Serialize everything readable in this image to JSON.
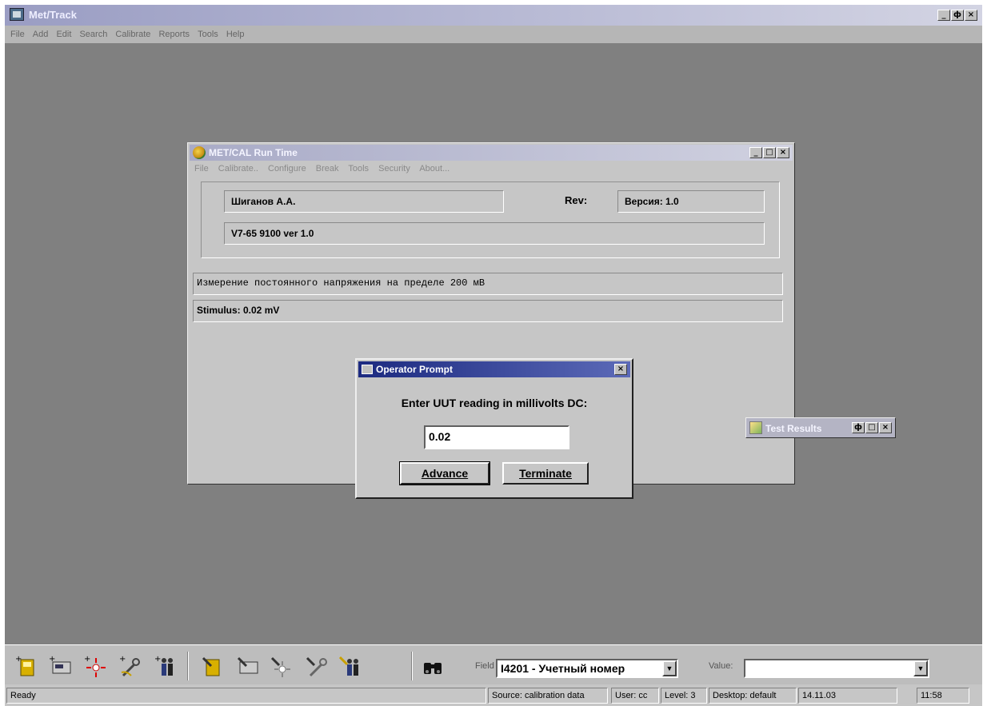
{
  "app": {
    "title": "Met/Track",
    "menu": [
      "File",
      "Add",
      "Edit",
      "Search",
      "Calibrate",
      "Reports",
      "Tools",
      "Help"
    ],
    "window_controls": {
      "minimize": "_",
      "restore": "ф",
      "close": "×"
    }
  },
  "metcal": {
    "title": "MET/CAL Run Time",
    "menu": [
      "File",
      "Calibrate..",
      "Configure",
      "Break",
      "Tools",
      "Security",
      "About..."
    ],
    "operator_name": "Шиганов А.А.",
    "rev_label": "Rev:",
    "rev_value": "Версия: 1.0",
    "procedure": "V7-65 9100 ver 1.0",
    "step_description": "Измерение постоянного напряжения на пределе 200 мВ",
    "stimulus": "Stimulus:  0.02 mV"
  },
  "prompt": {
    "title": "Operator Prompt",
    "message": "Enter UUT reading in millivolts DC:",
    "input_value": "0.02",
    "advance_label": "Advance",
    "terminate_label": "Terminate"
  },
  "test_results": {
    "title": "Test Results"
  },
  "toolbar": {
    "field_label": "Field",
    "field_value": "I4201 - Учетный номер",
    "value_label": "Value:",
    "value_value": ""
  },
  "status": {
    "ready": "Ready",
    "source": "Source: calibration data",
    "user": "User: cc",
    "level": "Level: 3",
    "desktop": "Desktop: default",
    "date": "14.11.03",
    "time": "11:58"
  },
  "colors": {
    "desktop": "#808080",
    "prompt_title": "#1c2a80"
  }
}
